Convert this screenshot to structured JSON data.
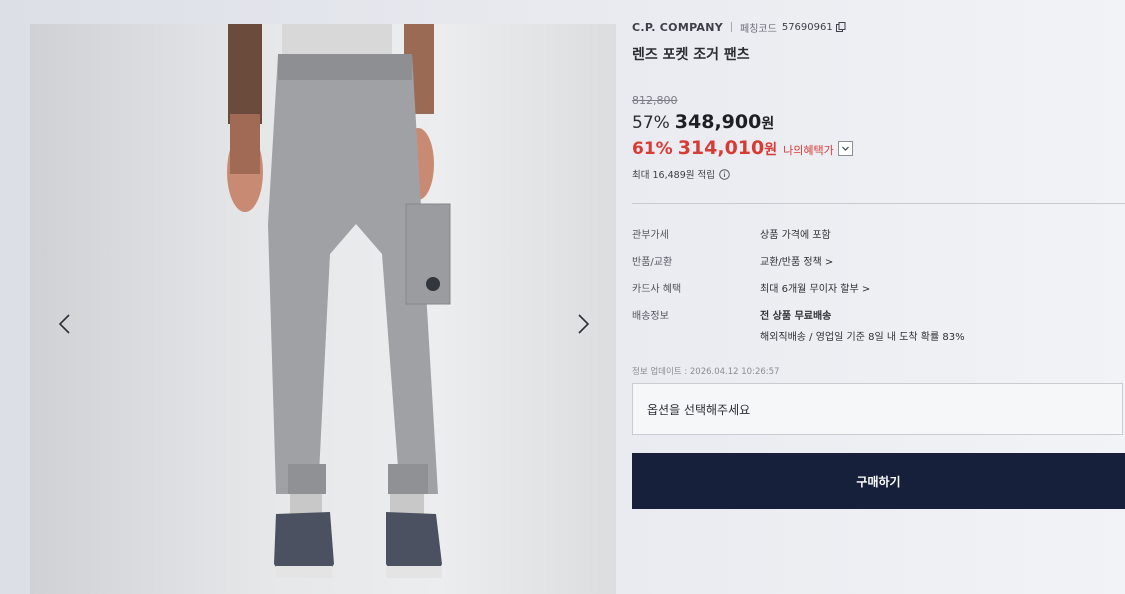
{
  "product": {
    "brand": "C.P. COMPANY",
    "code_label": "페칭코드",
    "code": "57690961",
    "title": "렌즈 포켓 조거 팬츠"
  },
  "pricing": {
    "original_price": "812,800",
    "discount_pct": "57%",
    "sale_price": "348,900",
    "currency_unit": "원",
    "benefit_pct": "61%",
    "benefit_price": "314,010",
    "benefit_label": "나의혜택가",
    "points_text": "최대 16,489원 적립"
  },
  "details": {
    "rows": [
      {
        "label": "관부가세",
        "value": "상품 가격에 포함"
      },
      {
        "label": "반품/교환",
        "value": "교환/반품 정책 >"
      },
      {
        "label": "카드사 혜택",
        "value": "최대 6개월 무이자 할부 >"
      },
      {
        "label": "배송정보",
        "value": "전 상품 무료배송",
        "sub": "해외직배송 / 영업일 기준 8일 내 도착 확률 83%"
      }
    ]
  },
  "update_text": "정보 업데이트 : 2026.04.12 10:26:57",
  "option_placeholder": "옵션을 선택해주세요",
  "buy_label": "구매하기",
  "colors": {
    "accent_red": "#d83a34",
    "buy_button": "#16203a"
  },
  "icons": [
    "chevron-left-icon",
    "chevron-right-icon",
    "copy-icon",
    "chevron-down-icon",
    "info-icon"
  ]
}
